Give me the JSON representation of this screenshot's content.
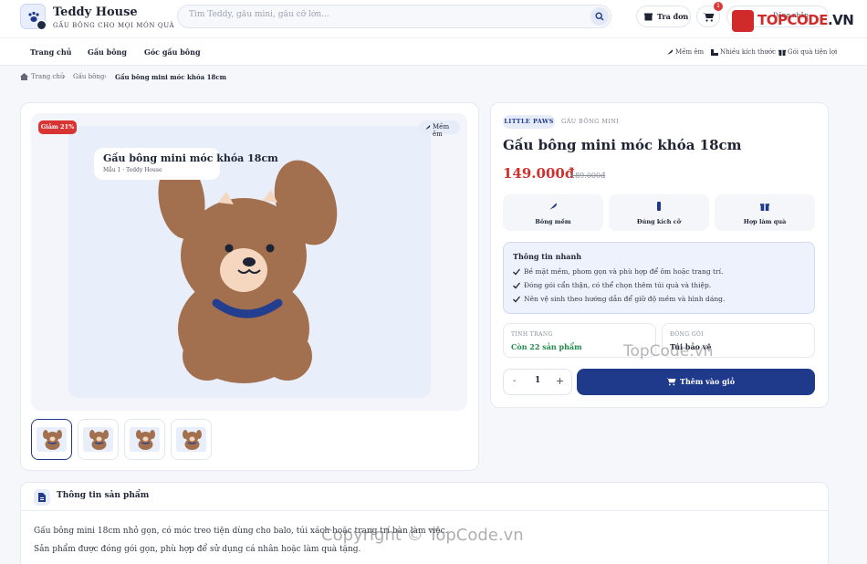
{
  "header": {
    "brand_name": "Teddy House",
    "brand_tagline": "GẤU BÔNG CHO MỌI MÓN QUÀ",
    "search_placeholder": "Tìm Teddy, gấu mini, gấu cỡ lớn...",
    "track_order_label": "Tra đơn",
    "cart_count": "1",
    "account_label": "Đăng nhập"
  },
  "nav": {
    "items": [
      "Trang chủ",
      "Gấu bông",
      "Góc gấu bông"
    ],
    "right_items": [
      "Mềm êm",
      "Nhiều kích thước",
      "Gói quà tiện lợi"
    ]
  },
  "breadcrumb": [
    "Trang chủ",
    "Gấu bông",
    "Gấu bông mini móc khóa 18cm"
  ],
  "gallery": {
    "discount_badge": "Giảm 21%",
    "soft_chip": "Mềm êm",
    "label_title": "Gấu bông mini móc khóa 18cm",
    "label_sub": "Mẫu 1 · Teddy House",
    "thumb_count": 4,
    "active_thumb": 1,
    "bear_color": "#a3704f",
    "ribbon_color": "#233d8f"
  },
  "product": {
    "brand_chip": "LITTLE PAWS",
    "category": "GẤU BÔNG MINI",
    "title": "Gấu bông mini móc khóa 18cm",
    "price": "149.000đ",
    "old_price": "189.000đ",
    "features": [
      "Bông mềm",
      "Đúng kích cỡ",
      "Hợp làm quà"
    ],
    "quick_info_title": "Thông tin nhanh",
    "quick_info": [
      "Bề mặt mềm, phom gọn và phù hợp để ôm hoặc trang trí.",
      "Đóng gói cẩn thận, có thể chọn thêm túi quà và thiệp.",
      "Nên vệ sinh theo hướng dẫn để giữ độ mềm và hình dáng."
    ],
    "status_label": "TÌNH TRẠNG",
    "status_value": "Còn 22 sản phẩm",
    "packing_label": "ĐÓNG GÓI",
    "packing_value": "Túi bảo vệ",
    "quantity": "1",
    "add_to_cart_label": "Thêm vào giỏ",
    "accent_color": "#1f3a8a",
    "price_color": "#d0312d"
  },
  "description": {
    "title": "Thông tin sản phẩm",
    "lines": [
      "Gấu bông mini 18cm nhỏ gọn, có móc treo tiện dùng cho balo, túi xách hoặc trang trí bàn làm việc.",
      "Sản phẩm được đóng gói gọn, phù hợp để sử dụng cá nhân hoặc làm quà tặng."
    ]
  },
  "watermarks": {
    "logo_text_1": "TOPCODE",
    "logo_text_2": ".VN",
    "middle": "TopCode.vn",
    "bottom": "Copyright © TopCode.vn"
  }
}
